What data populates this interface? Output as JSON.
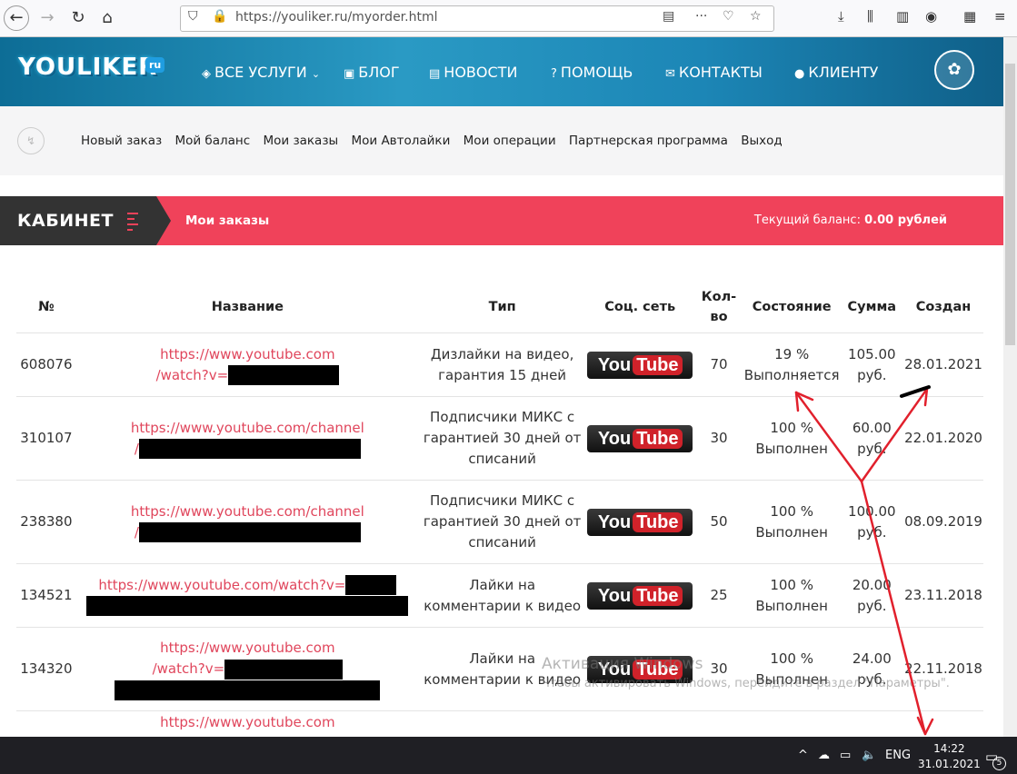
{
  "browser": {
    "url_host": "https://youliker.ru",
    "url_path": "/myorder.html"
  },
  "site": {
    "logo": "YOULIKER",
    "logo_suffix": "ru",
    "nav": [
      "ВСЕ УСЛУГИ",
      "БЛОГ",
      "НОВОСТИ",
      "ПОМОЩЬ",
      "КОНТАКТЫ",
      "КЛИЕНТУ"
    ]
  },
  "subnav": {
    "links": [
      "Новый заказ",
      "Мой баланс",
      "Мои заказы",
      "Мои Автолайки",
      "Мои операции",
      "Партнерская программа",
      "Выход"
    ]
  },
  "cabinet": {
    "title": "КАБИНЕТ",
    "subtitle": "Мои заказы",
    "balance_label": "Текущий баланс:",
    "balance_value": "0.00 рублей"
  },
  "table": {
    "headers": [
      "№",
      "Название",
      "Тип",
      "Соц. сеть",
      "Кол-во",
      "Состояние",
      "Сумма",
      "Создан"
    ],
    "rows": [
      {
        "id": "608076",
        "link1": "https://www.youtube.com",
        "link2": "/watch?v=",
        "type": "Дизлайки на видео, гарантия 15 дней",
        "network": "YouTube",
        "qty": "70",
        "pct": "19 %",
        "state": "Выполняется",
        "sum": "105.00",
        "cur": "руб.",
        "date": "28.01.2021"
      },
      {
        "id": "310107",
        "link1": "https://www.youtube.com/channel",
        "link2": "/",
        "type": "Подписчики МИКС с гарантией 30 дней от списаний",
        "network": "YouTube",
        "qty": "30",
        "pct": "100 %",
        "state": "Выполнен",
        "sum": "60.00",
        "cur": "руб.",
        "date": "22.01.2020"
      },
      {
        "id": "238380",
        "link1": "https://www.youtube.com/channel",
        "link2": "/",
        "type": "Подписчики МИКС с гарантией 30 дней от списаний",
        "network": "YouTube",
        "qty": "50",
        "pct": "100 %",
        "state": "Выполнен",
        "sum": "100.00",
        "cur": "руб.",
        "date": "08.09.2019"
      },
      {
        "id": "134521",
        "link1": "https://www.youtube.com/watch?v=",
        "link2": "",
        "type": "Лайки на комментарии к видео",
        "network": "YouTube",
        "qty": "25",
        "pct": "100 %",
        "state": "Выполнен",
        "sum": "20.00",
        "cur": "руб.",
        "date": "23.11.2018"
      },
      {
        "id": "134320",
        "link1": "https://www.youtube.com",
        "link2": "/watch?v=",
        "type": "Лайки на комментарии к видео",
        "network": "YouTube",
        "qty": "30",
        "pct": "100 %",
        "state": "Выполнен",
        "sum": "24.00",
        "cur": "руб.",
        "date": "22.11.2018"
      }
    ],
    "partial_link": "https://www.youtube.com"
  },
  "watermark": {
    "line1": "Активация Windows",
    "line2": "Чтобы активировать Windows, перейдите в раздел \"Параметры\"."
  },
  "taskbar": {
    "lang": "ENG",
    "time": "14:22",
    "date": "31.01.2021",
    "notif_count": "5"
  }
}
